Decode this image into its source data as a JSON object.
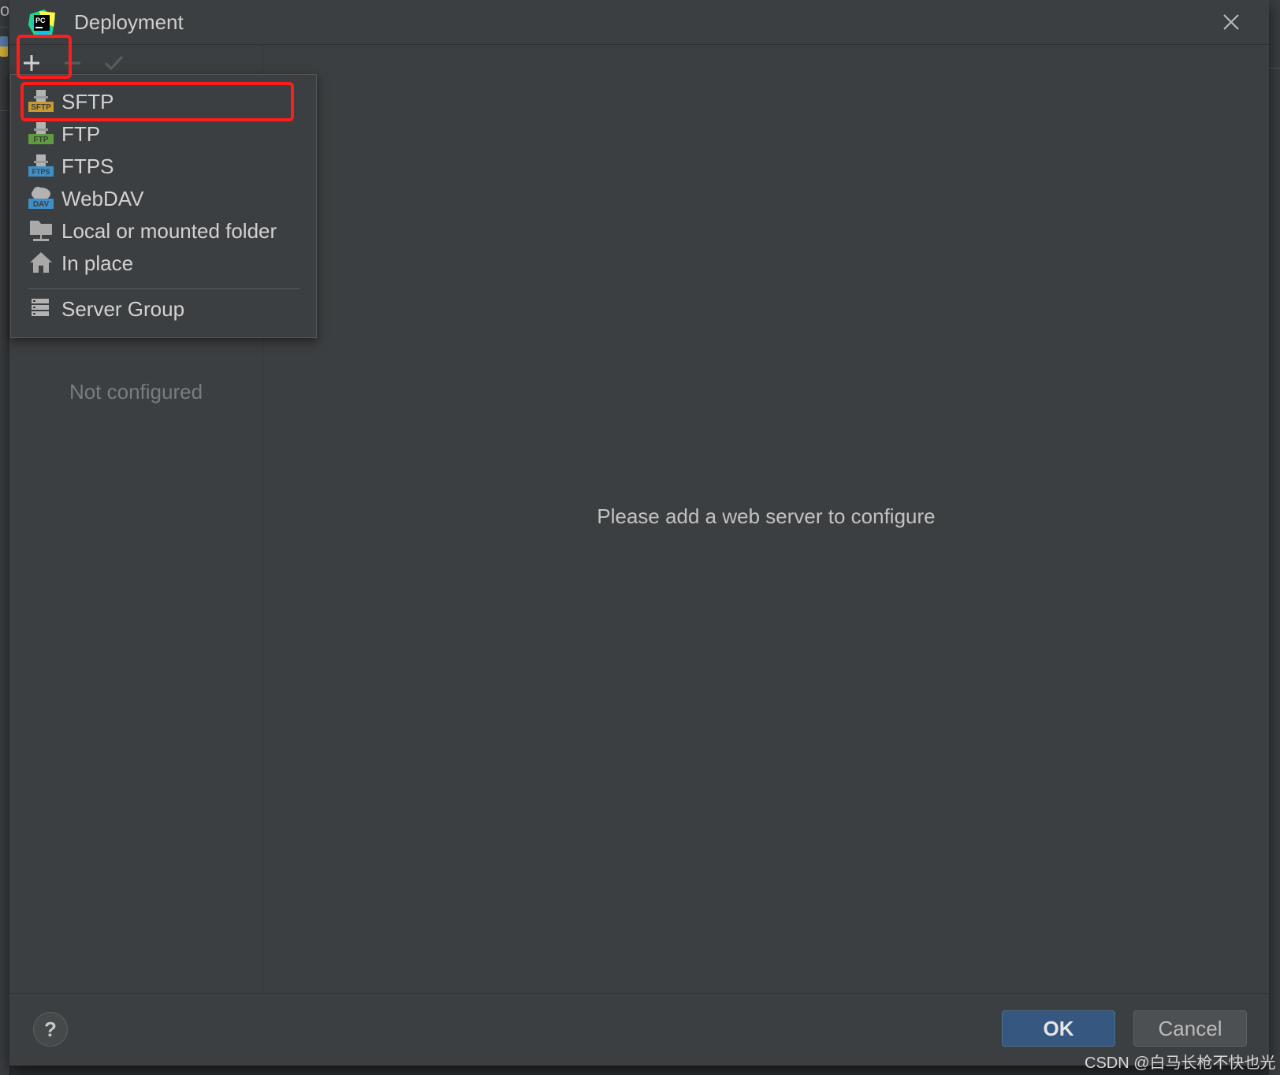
{
  "window": {
    "title": "Deployment",
    "app_icon": "pycharm-logo",
    "edge_left_char": "o"
  },
  "toolbar": {
    "add_icon": "plus-icon",
    "remove_icon": "minus-icon",
    "apply_icon": "check-icon"
  },
  "add_menu": {
    "items": [
      {
        "label": "SFTP",
        "icon": "sftp-icon",
        "badge": "SFTP",
        "badge_color": "#c99a2e"
      },
      {
        "label": "FTP",
        "icon": "ftp-icon",
        "badge": "FTP",
        "badge_color": "#5e9c3e"
      },
      {
        "label": "FTPS",
        "icon": "ftps-icon",
        "badge": "FTPS",
        "badge_color": "#3f8fc7"
      },
      {
        "label": "WebDAV",
        "icon": "webdav-icon",
        "badge": "DAV",
        "badge_color": "#3f8fc7"
      },
      {
        "label": "Local or mounted folder",
        "icon": "folder-icon"
      },
      {
        "label": "In place",
        "icon": "home-icon"
      },
      {
        "label": "Server Group",
        "icon": "server-group-icon"
      }
    ]
  },
  "left_panel": {
    "empty_text": "Not configured"
  },
  "main": {
    "placeholder": "Please add a web server to configure"
  },
  "footer": {
    "help_label": "?",
    "ok_label": "OK",
    "cancel_label": "Cancel"
  },
  "watermark": "CSDN @白马长枪不快也光",
  "colors": {
    "dialog_bg": "#3c3f41",
    "accent_ok": "#365880",
    "annotation": "#ff1c1c"
  }
}
